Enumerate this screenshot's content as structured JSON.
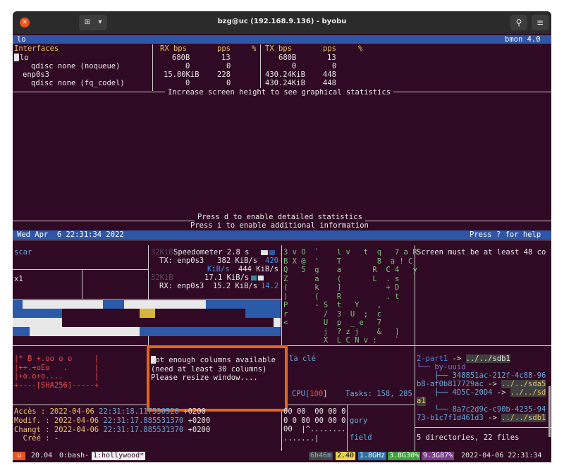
{
  "window": {
    "title": "bzg@uc (192.168.9.136) - byobu",
    "close_icon": "✕",
    "new_tab_icon": "⊞",
    "menu_caret": "▾",
    "search_icon": "⚲",
    "hamburger_icon": "≡"
  },
  "bmon": {
    "iface": "lo",
    "version": "bmon 4.0",
    "headers": {
      "interfaces": "Interfaces",
      "rx_bps": "RX bps",
      "rx_pps": "pps",
      "rx_pct": "%",
      "tx_bps": "TX bps",
      "tx_pps": "pps",
      "tx_pct": "%"
    },
    "rows": [
      {
        "name": "lo",
        "rx_bps": "680B",
        "rx_pps": "13",
        "tx_bps": "680B",
        "tx_pps": "13"
      },
      {
        "name": "qdisc none (noqueue)",
        "rx_bps": "0",
        "rx_pps": "0",
        "tx_bps": "0",
        "tx_pps": "0"
      },
      {
        "name": "enp0s3",
        "rx_bps": "15.00KiB",
        "rx_pps": "228",
        "tx_bps": "430.24KiB",
        "tx_pps": "448"
      },
      {
        "name": "qdisc none (fq_codel)",
        "rx_bps": "0",
        "rx_pps": "0",
        "tx_bps": "430.24KiB",
        "tx_pps": "448"
      }
    ],
    "increase_msg": "Increase screen height to see graphical statistics",
    "detailed_msg": "Press d to enable detailed statistics",
    "additional_msg": "Press i to enable additional information",
    "date": "Wed Apr  6 22:31:34 2022",
    "help": "Press ? for help"
  },
  "hollywood": {
    "scar": "scar",
    "x1": "x1",
    "speedometer": {
      "title": "Speedometer 2.8 s",
      "tx_line": "TX: enp0s3   382 KiB/s",
      "tx_val": "420",
      "kib": "KiB/s",
      "kib_val": "444 KiB/s",
      "label32k_a": "32KiB",
      "label32k_b": "32KiB",
      "mid_val": "17.1 KiB/s",
      "rx_line": "RX: enp0s3  15.2 KiB/s",
      "rx_val": "14.2"
    },
    "matrix_lines": [
      "3 v O  `    l v   t  q   7 a R",
      "B X @  '    T        8  a ! C",
      "Q   5  g    a       R  C 4   y",
      "Z      a    (       L  . s",
      "(      k    ]          + D",
      ")      (    R          . t",
      "P      - S  t   Y    ,",
      "r        /  3  U  ;  c",
      "<        U  p  _ e   7",
      "         j  ? z j    &   ]",
      "         X  L C N v :    `"
    ],
    "screen_msg": "Screen must be at least 48 co",
    "hash_lines": [
      "|* B +.oo o o     |",
      "|++.+oEo   .      |",
      "|+o.o+o....       |",
      "+----[SHA256]-----+"
    ],
    "warn_lines": [
      "Not enough columns available",
      "(need at least 30 columns)",
      "Please resize window...."
    ],
    "la_cle": "la clé",
    "cpu": "CPU[",
    "cpu_val": "100",
    "cpu_end": "]",
    "tasks": "Tasks: 158, 285",
    "tree": {
      "l1a": "2-part1",
      "l1b": " -> ",
      "l1c": "../../sdb1",
      "l2": "└── by-uuid",
      "l3a": "    ├── 348851ac-212f-4c88-96",
      "l4a": "b8-af0b817729ac",
      "l4b": " -> ",
      "l4c": "../../sda5",
      "l5a": "    ├── 4D5C-20D4",
      "l5b": " -> ",
      "l5c": "../../sd",
      "l6a": "a1",
      "l7a": "    └── 8a7c2d9c-c90b-4235-94",
      "l8a": "73-b1c7f1d461d3",
      "l8b": " -> ",
      "l8c": "../../sdb1",
      "summary": "5 directories, 22 files"
    },
    "stat": [
      {
        "label": "Accès : ",
        "date": "2022-04-06 ",
        "time": "22:31:18.117530528",
        "tz": " +0200"
      },
      {
        "label": "Modif. : ",
        "date": "2022-04-06 ",
        "time": "22:31:17.885531370",
        "tz": " +0200"
      },
      {
        "label": "Changt : ",
        "date": "2022-04-06 ",
        "time": "22:31:17.885531370",
        "tz": " +0200"
      },
      {
        "label": "  Créé : ",
        "date": "-",
        "time": "",
        "tz": ""
      }
    ],
    "hex_lines": [
      "00 00  00 00 0",
      "0 0 00 00 00 0",
      "00  |^........",
      ".......|"
    ],
    "gory": "gory",
    "field": "field"
  },
  "statusbar": {
    "u": "u",
    "version": " 20.04 ",
    "win0": "0:bash-",
    "win1": "1:hollywood*",
    "uptime": "6h46m",
    "load": "2.40",
    "freq": "1.8GHz",
    "mem": "3.8G30%",
    "disk": "9.3G87%",
    "datetime": " 2022-04-06 22:31:34 "
  },
  "colors": {
    "accent": "#e95420",
    "bar_blue": "#2f56a6",
    "terminal_bg": "#300a24",
    "warn_border": "#e8650f"
  }
}
